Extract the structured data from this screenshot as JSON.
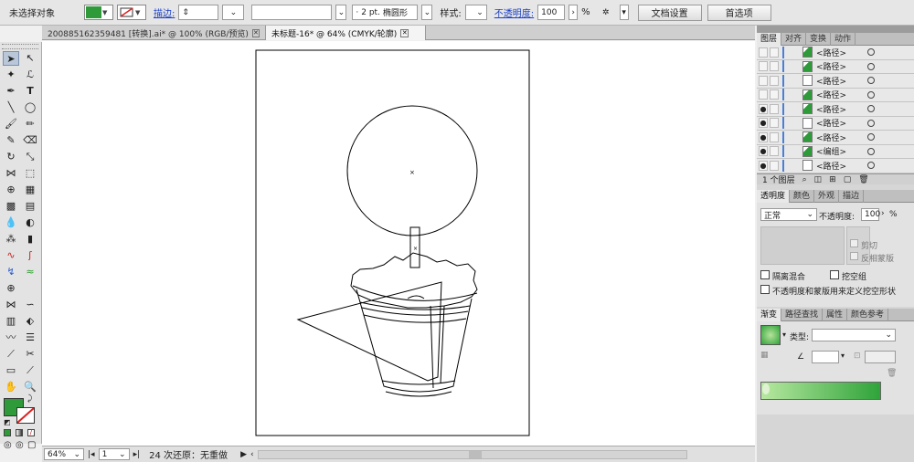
{
  "control_bar": {
    "selection_status": "未选择对象",
    "stroke_link": "描边:",
    "brush_size": "2 pt.",
    "brush_shape": "椭圆形",
    "style_label": "样式:",
    "opacity_link": "不透明度:",
    "opacity_value": "100",
    "opacity_unit": "%",
    "doc_setup_button": "文档设置",
    "preferences_button": "首选项",
    "fill_color": "#2e9a3a"
  },
  "tabs": [
    {
      "label": "200885162359481 [转换].ai* @ 100% (RGB/预览)"
    },
    {
      "label": "未标题-16* @ 64% (CMYK/轮廓)"
    }
  ],
  "status_bar": {
    "zoom": "64%",
    "artboard": "1",
    "undo_status": "24 次还原：无重做"
  },
  "layers_panel": {
    "tabs": [
      "图层",
      "对齐",
      "变换",
      "动作"
    ],
    "rows": [
      {
        "name": "<路径>",
        "visible": false
      },
      {
        "name": "<路径>",
        "visible": false
      },
      {
        "name": "<路径>",
        "visible": false
      },
      {
        "name": "<路径>",
        "visible": false
      },
      {
        "name": "<路径>",
        "visible": true
      },
      {
        "name": "<路径>",
        "visible": true
      },
      {
        "name": "<路径>",
        "visible": true
      },
      {
        "name": "<编组>",
        "visible": true
      },
      {
        "name": "<路径>",
        "visible": true
      }
    ],
    "footer": "1 个图层"
  },
  "transparency_panel": {
    "tabs": [
      "透明度",
      "颜色",
      "外观",
      "描边"
    ],
    "blend_mode": "正常",
    "opacity_label": "不透明度:",
    "opacity_value": "100",
    "opacity_unit": "%",
    "clip_label": "剪切",
    "invert_mask_label": "反相蒙版",
    "isolate_blending": "隔离混合",
    "knockout_group": "挖空组",
    "opacity_mask_knockout": "不透明度和蒙版用来定义挖空形状"
  },
  "gradient_panel": {
    "tabs": [
      "渐变",
      "路径查找",
      "属性",
      "颜色参考"
    ],
    "type_label": "类型:",
    "gradient_start": "#2fa33a",
    "gradient_end": "#b7e8a0"
  }
}
